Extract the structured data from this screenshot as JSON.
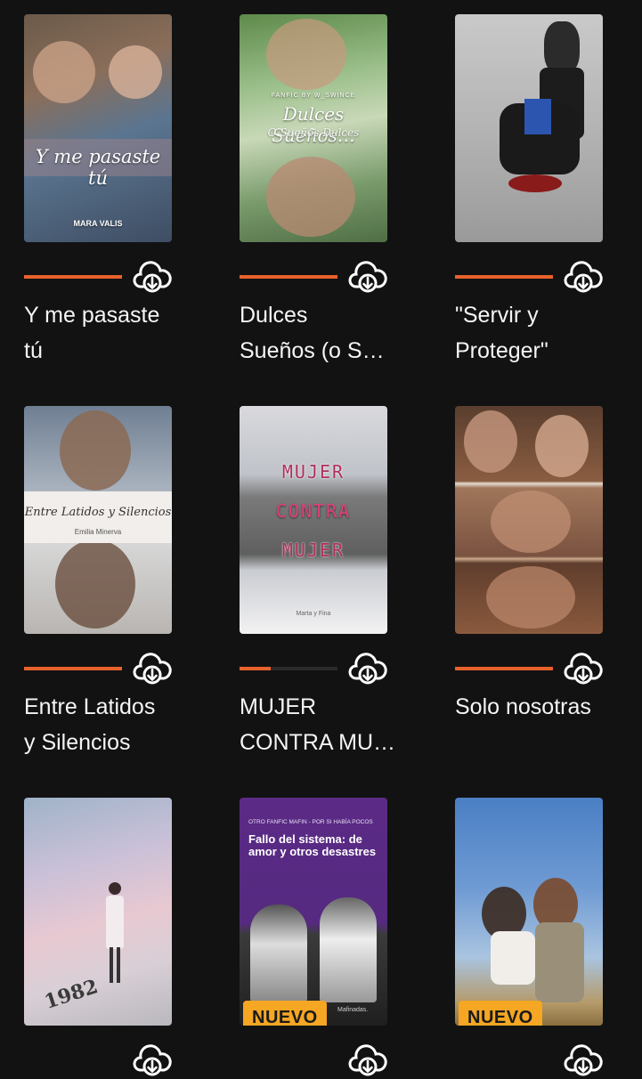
{
  "colors": {
    "accent": "#e8622c",
    "badge": "#f5a623",
    "background": "#121212"
  },
  "books": [
    {
      "title": "Y me pasaste\ntú",
      "cover_text": "Y me pasaste tú",
      "cover_author": "MARA VALIS",
      "progress": 1.0
    },
    {
      "title": "Dulces\nSueños (o S…",
      "cover_text": "Dulces Sueños…",
      "cover_sub": "O Sueños Dulces",
      "cover_top": "FANFIC BY W_SWINCE",
      "progress": 1.0
    },
    {
      "title": "\"Servir y\nProteger\"",
      "progress": 1.0
    },
    {
      "title": "Entre Latidos\ny Silencios",
      "cover_text": "Entre Latidos y Silencios",
      "cover_author": "Emilia Minerva",
      "progress": 1.0
    },
    {
      "title": "MUJER\nCONTRA MU…",
      "cover_l1": "MUJER",
      "cover_l2": "CONTRA",
      "cover_l3": "MUJER",
      "cover_author": "Marta y Fina",
      "progress": 0.32
    },
    {
      "title": "Solo nosotras",
      "progress": 1.0
    },
    {
      "title": "",
      "cover_text": "1982"
    },
    {
      "title": "",
      "cover_top": "OTRO FANFIC MAFIN - POR SI HABÍA POCOS",
      "cover_text": "Fallo del sistema: de amor y otros desastres",
      "cover_author": "Mafinadas.",
      "badge": "NUEVO"
    },
    {
      "title": "",
      "badge": "NUEVO"
    }
  ],
  "icons": {
    "download": "cloud-download-icon"
  }
}
